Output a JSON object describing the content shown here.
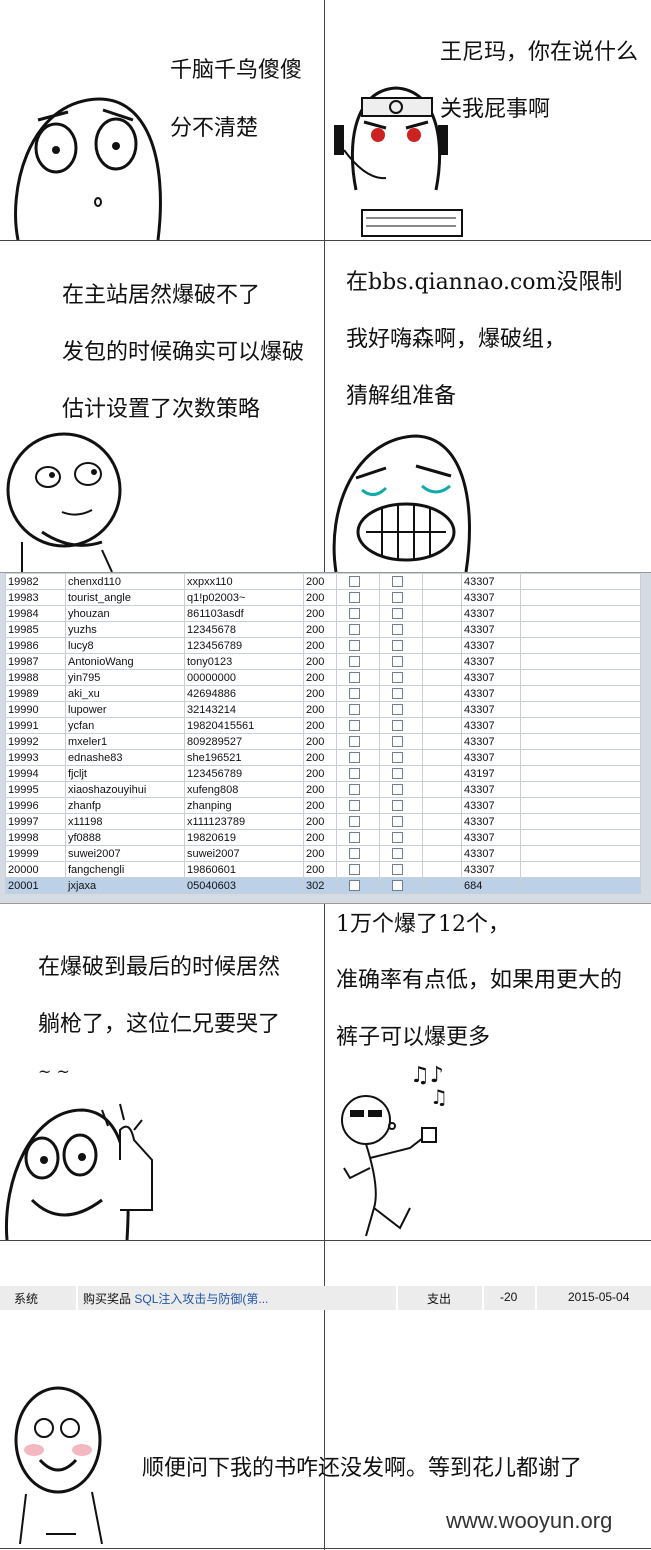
{
  "panels": {
    "p1": {
      "line1": "千脑千鸟傻傻",
      "line2": "分不清楚"
    },
    "p2": {
      "line1": "王尼玛，你在说什么",
      "line2": "关我屁事啊"
    },
    "p3": {
      "line1": "在主站居然爆破不了",
      "line2": "发包的时候确实可以爆破",
      "line3": "估计设置了次数策略"
    },
    "p4": {
      "line1": "在bbs.qiannao.com没限制",
      "line2": "我好嗨森啊，爆破组，",
      "line3": "猜解组准备"
    },
    "p5": {
      "line1": "在爆破到最后的时候居然",
      "line2": "躺枪了，这位仁兄要哭了",
      "line3": "~ ~"
    },
    "p6": {
      "line1": "1万个爆了12个，",
      "line2": "准确率有点低，如果用更大的",
      "line3": "裤子可以爆更多"
    },
    "p7": {
      "line1": "顺便问下我的书咋还没发啊。等到花儿都谢了"
    }
  },
  "results_table": {
    "rows": [
      [
        "19982",
        "chenxd110",
        "xxpxx110",
        "200",
        "43307"
      ],
      [
        "19983",
        "tourist_angle",
        "q1!p02003~",
        "200",
        "43307"
      ],
      [
        "19984",
        "yhouzan",
        "861103asdf",
        "200",
        "43307"
      ],
      [
        "19985",
        "yuzhs",
        "12345678",
        "200",
        "43307"
      ],
      [
        "19986",
        "lucy8",
        "123456789",
        "200",
        "43307"
      ],
      [
        "19987",
        "AntonioWang",
        "tony0123",
        "200",
        "43307"
      ],
      [
        "19988",
        "yin795",
        "00000000",
        "200",
        "43307"
      ],
      [
        "19989",
        "aki_xu",
        "42694886",
        "200",
        "43307"
      ],
      [
        "19990",
        "lupower",
        "32143214",
        "200",
        "43307"
      ],
      [
        "19991",
        "ycfan",
        "19820415561",
        "200",
        "43307"
      ],
      [
        "19992",
        "mxeler1",
        "809289527",
        "200",
        "43307"
      ],
      [
        "19993",
        "ednashe83",
        "she196521",
        "200",
        "43307"
      ],
      [
        "19994",
        "fjcljt",
        "123456789",
        "200",
        "43197"
      ],
      [
        "19995",
        "xiaoshazouyihui",
        "xufeng808",
        "200",
        "43307"
      ],
      [
        "19996",
        "zhanfp",
        "zhanping",
        "200",
        "43307"
      ],
      [
        "19997",
        "x11198",
        "x111123789",
        "200",
        "43307"
      ],
      [
        "19998",
        "yf0888",
        "19820619",
        "200",
        "43307"
      ],
      [
        "19999",
        "suwei2007",
        "suwei2007",
        "200",
        "43307"
      ],
      [
        "20000",
        "fangchengli",
        "19860601",
        "200",
        "43307"
      ],
      [
        "20001",
        "jxjaxa",
        "05040603",
        "302",
        "684"
      ]
    ]
  },
  "record": {
    "source": "系统",
    "item_prefix": "购买奖品",
    "item_link": "SQL注入攻击与防御(第...",
    "type": "支出",
    "amount": "-20",
    "date": "2015-05-04"
  },
  "watermark": "www.wooyun.org"
}
